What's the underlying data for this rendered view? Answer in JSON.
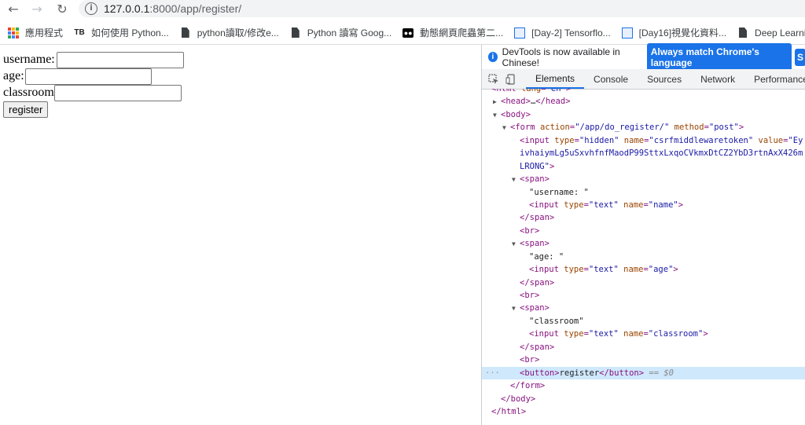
{
  "browser": {
    "url_host": "127.0.0.1",
    "url_rest": ":8000/app/register/"
  },
  "bookmarks": [
    {
      "label": "應用程式",
      "icon": "apps-grid-icon"
    },
    {
      "label": "如何使用 Python...",
      "icon": "tb-icon",
      "icon_text": "TB"
    },
    {
      "label": "python讀取/修改e...",
      "icon": "document-icon"
    },
    {
      "label": "Python 讀寫 Goog...",
      "icon": "document-icon"
    },
    {
      "label": "動態網頁爬蟲第二...",
      "icon": "medium-icon",
      "icon_text": "●●"
    },
    {
      "label": "[Day-2] Tensorflo...",
      "icon": "image-icon"
    },
    {
      "label": "[Day16]視覺化資料...",
      "icon": "image-icon"
    },
    {
      "label": "Deep Learnin",
      "icon": "document-icon"
    }
  ],
  "form": {
    "username_label": "username:",
    "age_label": "age:",
    "classroom_label": "classroom",
    "register_label": "register"
  },
  "devtools": {
    "banner_text": "DevTools is now available in Chinese!",
    "banner_button": "Always match Chrome's language",
    "banner_button2": "S",
    "tabs": [
      "Elements",
      "Console",
      "Sources",
      "Network",
      "Performance"
    ],
    "active_tab": "Elements"
  },
  "colors": {
    "accent": "#1a73e8",
    "tag": "#881280",
    "attr": "#994500",
    "value": "#1a1aa6",
    "selected_row": "#cfe8fc"
  }
}
